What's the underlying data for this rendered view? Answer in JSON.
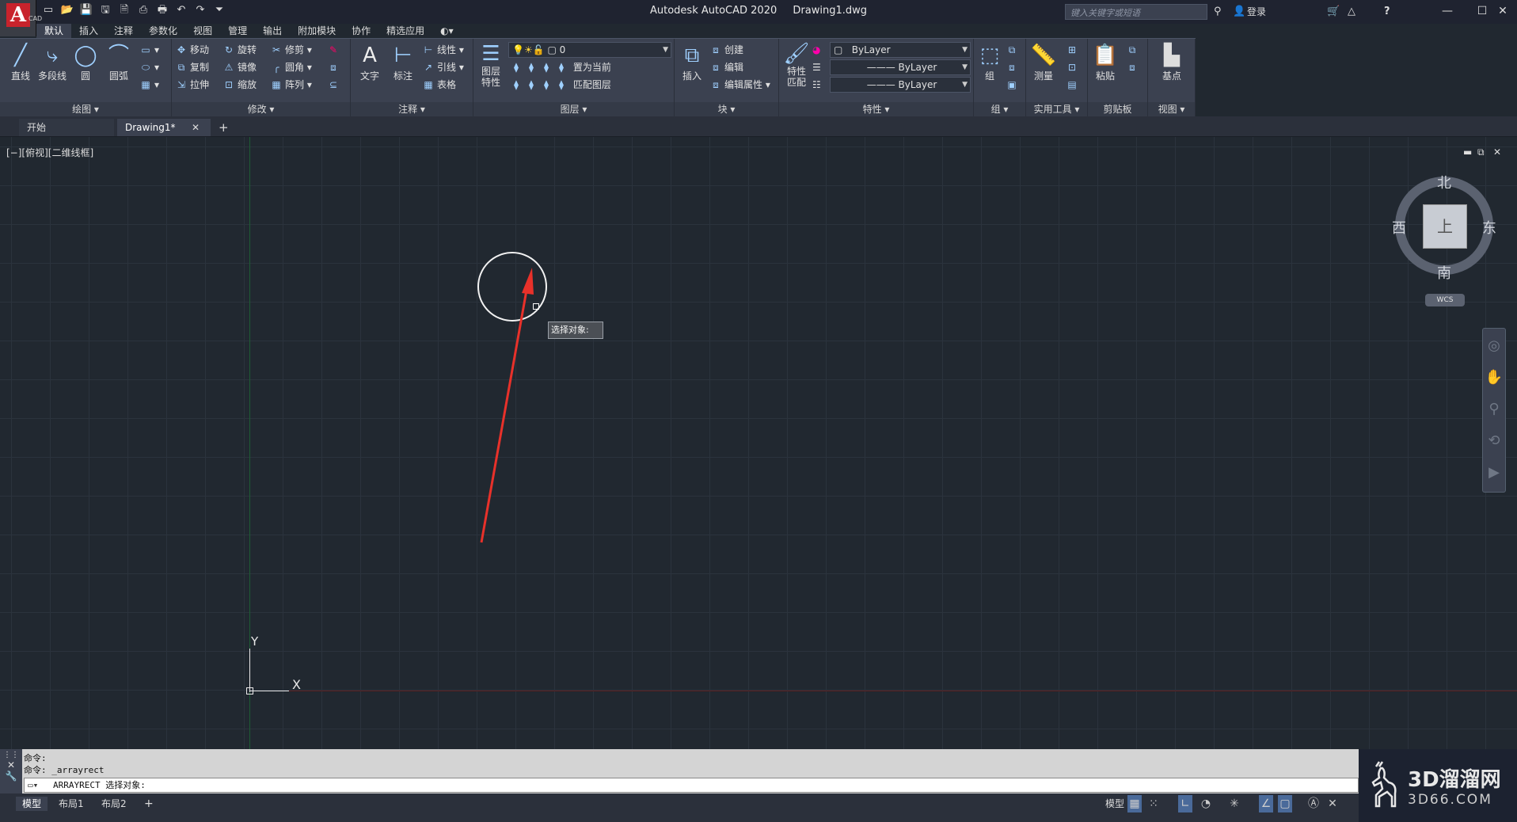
{
  "app": {
    "logo_letter": "A",
    "version_badge": "CAD",
    "title": "Autodesk AutoCAD 2020",
    "file": "Drawing1.dwg",
    "search_placeholder": "键入关键字或短语",
    "login": "登录",
    "help_icon": "?"
  },
  "menu_tabs": [
    "默认",
    "插入",
    "注释",
    "参数化",
    "视图",
    "管理",
    "输出",
    "附加模块",
    "协作",
    "精选应用"
  ],
  "ribbon": {
    "draw": {
      "label": "绘图",
      "line": "直线",
      "polyline": "多段线",
      "circle": "圆",
      "arc": "圆弧"
    },
    "modify": {
      "label": "修改",
      "move": "移动",
      "rotate": "旋转",
      "trim": "修剪",
      "copy": "复制",
      "mirror": "镜像",
      "fillet": "圆角",
      "stretch": "拉伸",
      "scale": "缩放",
      "array": "阵列"
    },
    "annotation": {
      "label": "注释",
      "text": "文字",
      "dimension": "标注",
      "linear": "线性",
      "leader": "引线",
      "table": "表格"
    },
    "layers": {
      "label": "图层",
      "props_line1": "图层",
      "props_line2": "特性",
      "current_layer": "0",
      "set_current": "置为当前",
      "match_layer": "匹配图层"
    },
    "block": {
      "label": "块",
      "insert": "插入",
      "create": "创建",
      "edit": "编辑",
      "edit_attr": "编辑属性"
    },
    "properties": {
      "label": "特性",
      "match_line1": "特性",
      "match_line2": "匹配",
      "color": "ByLayer",
      "linetype": "ByLayer",
      "lineweight": "ByLayer"
    },
    "groups": {
      "label": "组",
      "group": "组"
    },
    "utilities": {
      "label": "实用工具",
      "measure": "测量"
    },
    "clipboard": {
      "label": "剪贴板",
      "paste": "粘贴"
    },
    "view": {
      "label": "视图",
      "base": "基点"
    }
  },
  "doc_tabs": {
    "start": "开始",
    "drawing": "Drawing1*",
    "close": "✕",
    "add": "+"
  },
  "viewport": {
    "label": "[−][俯视][二维线框]",
    "tooltip": "选择对象:",
    "ucs_y": "Y",
    "ucs_x": "X",
    "viewcube": {
      "north": "北",
      "south": "南",
      "east": "东",
      "west": "西",
      "face": "上",
      "wcs": "WCS"
    }
  },
  "command": {
    "history": [
      "命令:",
      "命令: _arrayrect"
    ],
    "prompt": "ARRAYRECT 选择对象:"
  },
  "layout_tabs": [
    "模型",
    "布局1",
    "布局2"
  ],
  "status": {
    "model": "模型"
  },
  "watermark": {
    "line1": "3D溜溜网",
    "line2": "3D66.COM"
  }
}
